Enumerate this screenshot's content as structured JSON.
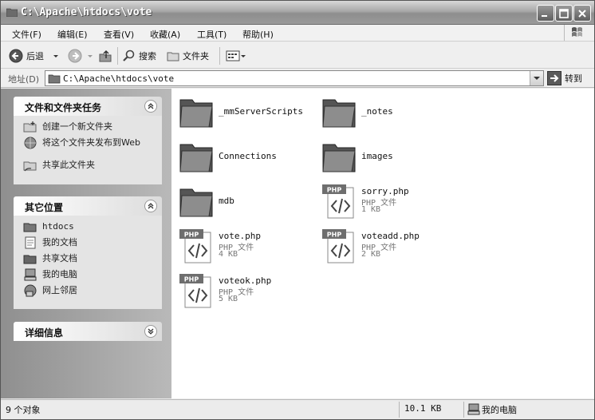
{
  "window": {
    "title": "C:\\Apache\\htdocs\\vote"
  },
  "menu": [
    "文件(F)",
    "编辑(E)",
    "查看(V)",
    "收藏(A)",
    "工具(T)",
    "帮助(H)"
  ],
  "toolbar": {
    "back": "后退",
    "search": "搜索",
    "folders": "文件夹"
  },
  "address": {
    "label": "地址(D)",
    "path": "C:\\Apache\\htdocs\\vote",
    "go": "转到"
  },
  "panels": {
    "tasks": {
      "title": "文件和文件夹任务",
      "items": [
        {
          "label": "创建一个新文件夹",
          "icon": "new-folder-icon"
        },
        {
          "label": "将这个文件夹发布到Web",
          "icon": "publish-web-icon"
        },
        {
          "label": "共享此文件夹",
          "icon": "share-folder-icon"
        }
      ]
    },
    "places": {
      "title": "其它位置",
      "items": [
        {
          "label": "htdocs",
          "icon": "folder-icon"
        },
        {
          "label": "我的文档",
          "icon": "my-documents-icon"
        },
        {
          "label": "共享文档",
          "icon": "shared-documents-icon"
        },
        {
          "label": "我的电脑",
          "icon": "my-computer-icon"
        },
        {
          "label": "网上邻居",
          "icon": "network-places-icon"
        }
      ]
    },
    "details": {
      "title": "详细信息"
    }
  },
  "files": [
    {
      "name": "_mmServerScripts",
      "kind": "folder"
    },
    {
      "name": "_notes",
      "kind": "folder"
    },
    {
      "name": "Connections",
      "kind": "folder"
    },
    {
      "name": "images",
      "kind": "folder"
    },
    {
      "name": "mdb",
      "kind": "folder"
    },
    {
      "name": "sorry.php",
      "kind": "php",
      "type": "PHP 文件",
      "size": "1 KB"
    },
    {
      "name": "vote.php",
      "kind": "php",
      "type": "PHP 文件",
      "size": "4 KB"
    },
    {
      "name": "voteadd.php",
      "kind": "php",
      "type": "PHP 文件",
      "size": "2 KB"
    },
    {
      "name": "voteok.php",
      "kind": "php",
      "type": "PHP 文件",
      "size": "5 KB"
    }
  ],
  "status": {
    "objects": "9 个对象",
    "size": "10.1 KB",
    "location": "我的电脑"
  },
  "php_badge": "PHP"
}
